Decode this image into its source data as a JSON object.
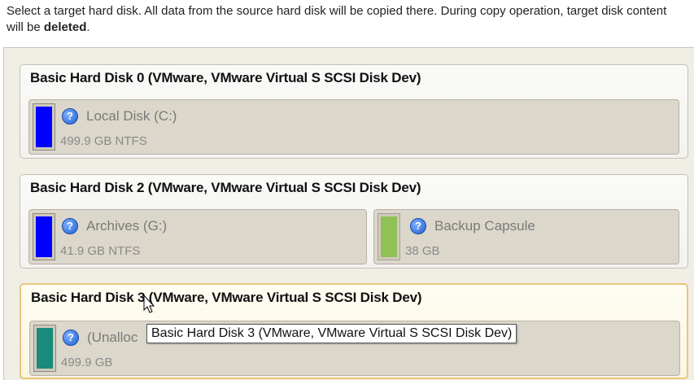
{
  "instructions": {
    "text_before": "Select a target hard disk. All data from the source hard disk will be copied there. During copy operation, target disk content will be ",
    "bold": "deleted",
    "text_after": "."
  },
  "disks": [
    {
      "title": "Basic Hard Disk 0 (VMware, VMware Virtual S SCSI Disk Dev)",
      "partitions": [
        {
          "name": "Local Disk (C:)",
          "info": "499.9 GB NTFS",
          "color": "#0000ff"
        }
      ]
    },
    {
      "title": "Basic Hard Disk 2 (VMware, VMware Virtual S SCSI Disk Dev)",
      "partitions": [
        {
          "name": "Archives (G:)",
          "info": "41.9 GB NTFS",
          "color": "#0000ff"
        },
        {
          "name": "Backup Capsule",
          "info": "38 GB",
          "color": "#8fc155"
        }
      ]
    },
    {
      "title": "Basic Hard Disk 3 (VMware, VMware Virtual S SCSI Disk Dev)",
      "selected": true,
      "partitions": [
        {
          "name": "(Unalloc",
          "info": "499.9 GB",
          "color": "#1a8a7a"
        }
      ]
    }
  ],
  "tooltip": "Basic Hard Disk 3 (VMware, VMware Virtual S SCSI Disk Dev)",
  "icons": {
    "help": "question-icon",
    "pointer": "mouse-cursor-icon"
  }
}
